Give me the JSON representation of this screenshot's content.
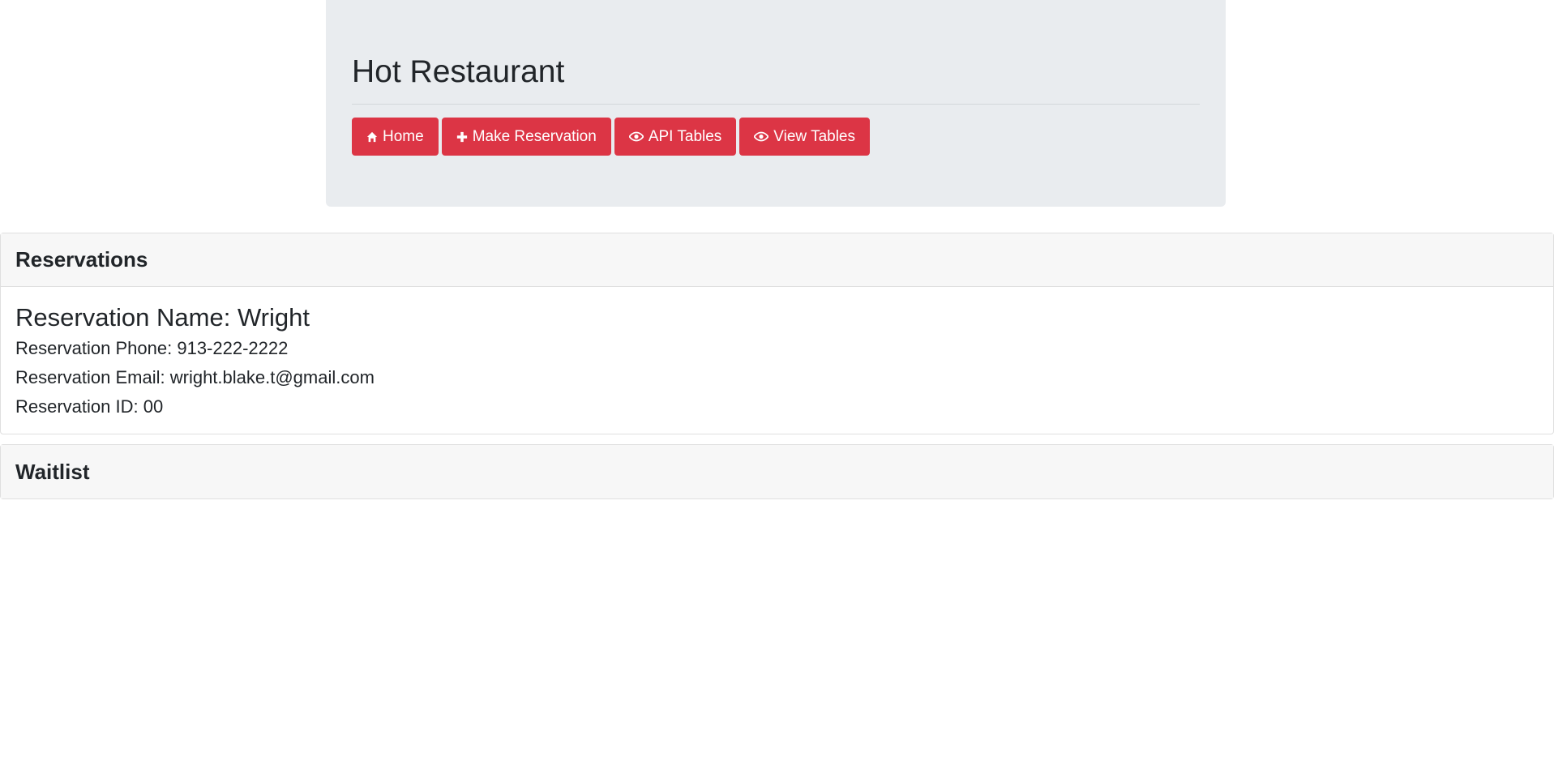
{
  "header": {
    "title": "Hot Restaurant",
    "buttons": [
      {
        "label": "Home",
        "icon": "home-icon"
      },
      {
        "label": "Make Reservation",
        "icon": "plus-icon"
      },
      {
        "label": "API Tables",
        "icon": "eye-icon"
      },
      {
        "label": "View Tables",
        "icon": "eye-icon"
      }
    ]
  },
  "reservations": {
    "heading": "Reservations",
    "items": [
      {
        "name": "Reservation Name: Wright",
        "phone": "Reservation Phone: 913-222-2222",
        "email": "Reservation Email: wright.blake.t@gmail.com",
        "id": "Reservation ID: 00"
      }
    ]
  },
  "waitlist": {
    "heading": "Waitlist"
  },
  "colors": {
    "accent": "#dc3545",
    "jumbotron_bg": "#e9ecef",
    "card_header_bg": "#f7f7f7"
  }
}
